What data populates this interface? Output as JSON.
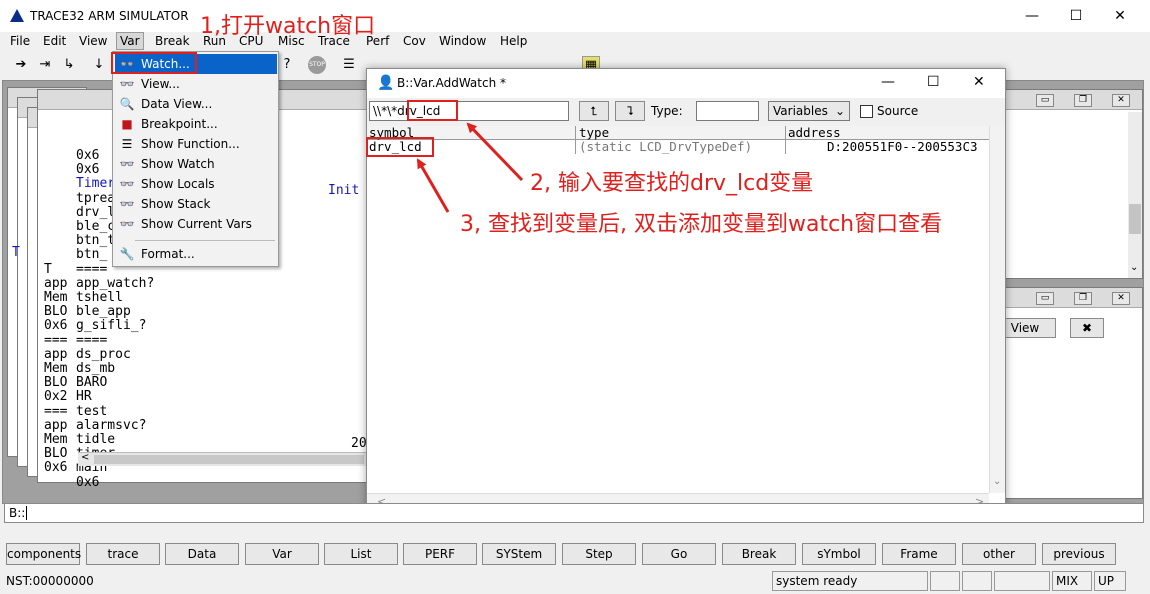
{
  "window": {
    "title": "TRACE32 ARM SIMULATOR",
    "minimize": "—",
    "maximize": "☐",
    "close": "✕"
  },
  "menubar": [
    "File",
    "Edit",
    "View",
    "Var",
    "Break",
    "Run",
    "CPU",
    "Misc",
    "Trace",
    "Perf",
    "Cov",
    "Window",
    "Help"
  ],
  "var_menu": {
    "items": [
      {
        "label": "Watch...",
        "icon": "glasses-icon"
      },
      {
        "label": "View...",
        "icon": "glasses-icon"
      },
      {
        "label": "Data View...",
        "icon": "magnifier-icon"
      },
      {
        "label": "Breakpoint...",
        "icon": "breakpoint-icon"
      },
      {
        "label": "Show Function...",
        "icon": "list-icon"
      },
      {
        "label": "Show Watch",
        "icon": "glasses-icon"
      },
      {
        "label": "Show Locals",
        "icon": "glasses-icon"
      },
      {
        "label": "Show Stack",
        "icon": "glasses-icon"
      },
      {
        "label": "Show Current Vars",
        "icon": "glasses-icon"
      },
      {
        "label": "Format...",
        "icon": "wrench-icon"
      }
    ]
  },
  "background_listing": {
    "col1": [
      "0x6",
      "0x6",
      "0x6",
      "0x6",
      "0x6",
      "0x6",
      "",
      "",
      "T",
      "a",
      "t",
      "a",
      "t",
      "a",
      "t",
      "a",
      "t",
      "a",
      "t",
      "a",
      "t",
      "a",
      "m"
    ],
    "col2": [
      "0x6",
      "0x6",
      "Timer",
      "tprea",
      "drv_l",
      "ble_c",
      "btn_t",
      "btn_",
      "====",
      "app_watch?",
      "tshell",
      "ble_app",
      "g_sifli_?",
      "====",
      "ds_proc",
      "ds_mb",
      "BARO",
      "HR",
      "test",
      "alarmsvc?",
      "tidle",
      "timer",
      "main",
      "0x6"
    ],
    "col_left": [
      "",
      "",
      "",
      "",
      "",
      "",
      "",
      "",
      "T",
      "app",
      "Mem",
      "BLO",
      "0x6",
      "===",
      "app",
      "Mem",
      "BLO",
      "0x2",
      "===",
      "app",
      "Mem",
      "BLO",
      "0x6"
    ],
    "init_label": "Init",
    "value_tail": "20"
  },
  "addwatch": {
    "title": "B::Var.AddWatch *",
    "prefix": "\\\\*\\*",
    "search_value": "drv_lcd",
    "type_label": "Type:",
    "type_value": "",
    "scope_select": "Variables",
    "source_label": "Source",
    "columns": [
      "symbol",
      "type",
      "address"
    ],
    "rows": [
      {
        "symbol": "drv_lcd",
        "type": "(static LCD_DrvTypeDef)",
        "address": "D:200551F0--200553C3"
      }
    ]
  },
  "right_window": {
    "view_button": "View",
    "close_button": "✖"
  },
  "annotations": {
    "step1": "1,打开watch窗口",
    "step2": "2, 输入要查找的drv_lcd变量",
    "step3": "3, 查找到变量后, 双击添加变量到watch窗口查看"
  },
  "command_line": {
    "prompt": "B::"
  },
  "softkeys": [
    "components",
    "trace",
    "Data",
    "Var",
    "List",
    "PERF",
    "SYStem",
    "Step",
    "Go",
    "Break",
    "sYmbol",
    "Frame",
    "other",
    "previous"
  ],
  "status": {
    "address": "NST:00000000",
    "state": "system ready",
    "mode": "MIX",
    "direction": "UP"
  },
  "colors": {
    "annotation_red": "#e0201c",
    "menu_highlight": "#0a63c9",
    "title_blue": "#1515c8"
  }
}
